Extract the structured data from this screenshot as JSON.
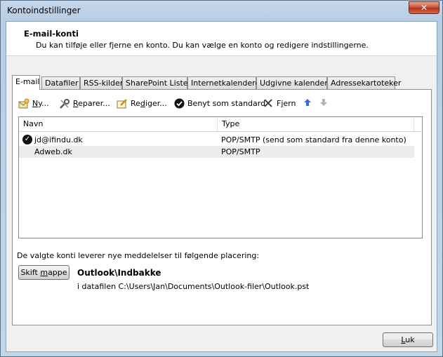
{
  "window": {
    "title": "Kontoindstillinger",
    "close_glyph": "✕"
  },
  "header": {
    "title": "E-mail-konti",
    "subtitle": "Du kan tilføje eller fjerne en konto. Du kan vælge en konto og redigere indstillingerne."
  },
  "tabs": [
    {
      "label": "E-mail",
      "active": true
    },
    {
      "label": "Datafiler"
    },
    {
      "label": "RSS-kilder"
    },
    {
      "label": "SharePoint Lister"
    },
    {
      "label": "Internetkalendere"
    },
    {
      "label": "Udgivne kalendere"
    },
    {
      "label": "Adressekartoteker"
    }
  ],
  "toolbar": {
    "new": {
      "label_underlined": "N",
      "label_rest": "y...",
      "icon": "new-account-icon"
    },
    "repair": {
      "label_underlined": "R",
      "label_rest": "eparer...",
      "icon": "repair-icon"
    },
    "edit": {
      "label_before": "Re",
      "label_underlined": "d",
      "label_rest": "iger...",
      "icon": "edit-icon"
    },
    "set_default": {
      "label": "Benyt som standard",
      "icon": "checkmark-icon"
    },
    "remove": {
      "label_before": "F",
      "label_underlined": "j",
      "label_rest": "ern",
      "icon": "x-icon"
    },
    "move_up": {
      "icon": "arrow-up-icon"
    },
    "move_down": {
      "icon": "arrow-down-icon"
    }
  },
  "accounts": {
    "columns": [
      "Navn",
      "Type"
    ],
    "rows": [
      {
        "name": "jd@ifindu.dk",
        "type": "POP/SMTP (send som standard fra denne konto)",
        "default": true
      },
      {
        "name": "Adweb.dk",
        "type": "POP/SMTP",
        "default": false
      }
    ]
  },
  "delivery": {
    "label": "De valgte konti leverer nye meddelelser til følgende placering:",
    "change_folder_before": "Skift ",
    "change_folder_underlined": "m",
    "change_folder_rest": "appe",
    "folder": "Outlook\\Indbakke",
    "path": "i datafilen C:\\Users\\Jan\\Documents\\Outlook-filer\\Outlook.pst"
  },
  "footer": {
    "close_underlined": "L",
    "close_rest": "uk"
  },
  "colors": {
    "accent_blue": "#2f6fd6",
    "window_frame": "#b7cde4",
    "close_red": "#c9492f"
  }
}
